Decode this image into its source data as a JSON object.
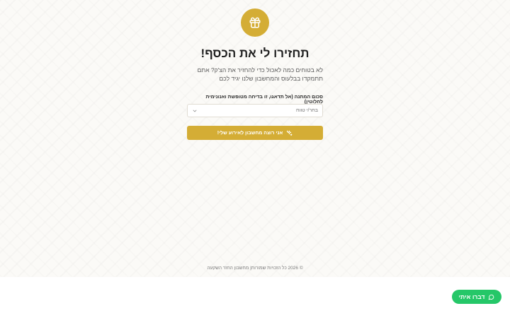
{
  "hero": {
    "icon": "gift-icon",
    "accent_color": "#d4ad35",
    "title": "תחזירו לי את הכסף!",
    "subtitle": "לא בטוחים כמה לאכול כדי להחזיר את הצ'ק? אתם תתמקדו בבלעוס והמחשבון שלנו יגיד לכם"
  },
  "form": {
    "amount_label": "סכום המתנה (אל תדאגו, זו בדיחה מטופשת ואנונימית לחלוטין)",
    "amount_select_value": "בחר/י טווח",
    "submit_label": "אני רוצה מחשבון לאירוע שלי!"
  },
  "footer": {
    "text": "© 2026 כל הזכויות שמורות| מחשבון החזר השקעה"
  },
  "chat": {
    "label": "דברו איתי",
    "color": "#25c768"
  }
}
